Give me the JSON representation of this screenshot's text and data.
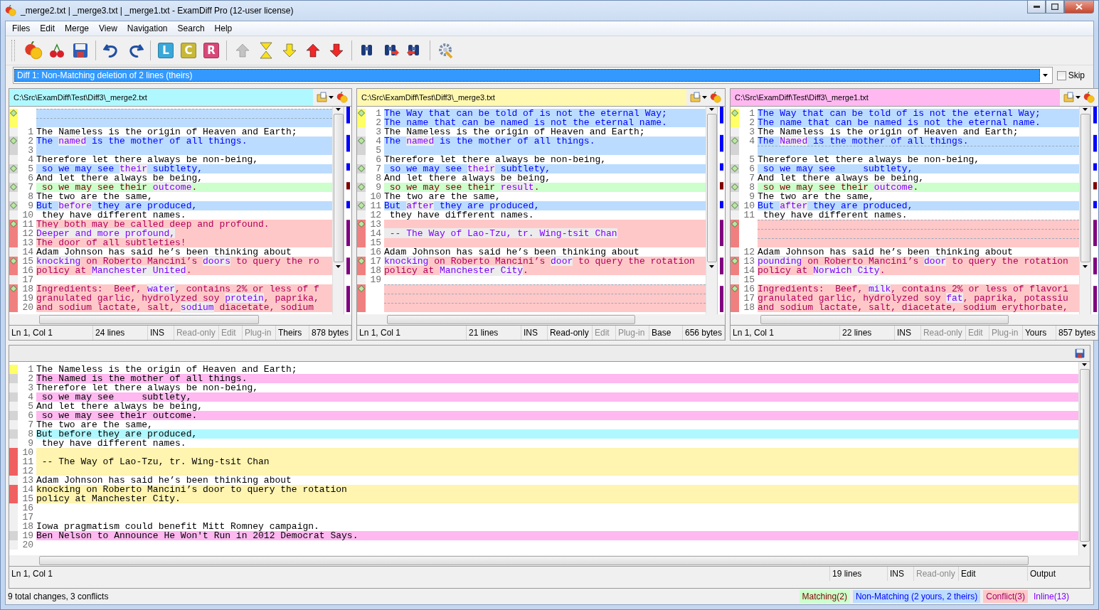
{
  "window": {
    "title": "_merge2.txt  |  _merge3.txt  |  _merge1.txt - ExamDiff Pro (12-user license)"
  },
  "menu": [
    "Files",
    "Edit",
    "Merge",
    "View",
    "Navigation",
    "Search",
    "Help"
  ],
  "toolbar": [
    [
      {
        "kind": "compare",
        "disabled": false
      },
      {
        "kind": "merge",
        "disabled": false
      },
      {
        "kind": "save",
        "disabled": false
      }
    ],
    [
      {
        "kind": "undo",
        "disabled": false
      },
      {
        "kind": "redo",
        "disabled": false
      }
    ],
    [
      {
        "kind": "letter",
        "label": "L",
        "color": "#3aa8d8",
        "disabled": false
      },
      {
        "kind": "letter",
        "label": "C",
        "color": "#c8b838",
        "disabled": false
      },
      {
        "kind": "letter",
        "label": "R",
        "color": "#d84878",
        "disabled": false
      }
    ],
    [
      {
        "kind": "prev-diff",
        "disabled": true
      },
      {
        "kind": "current-diff",
        "disabled": false
      },
      {
        "kind": "next-diff",
        "disabled": false
      },
      {
        "kind": "prev-conflict",
        "disabled": false
      },
      {
        "kind": "next-conflict",
        "disabled": false
      }
    ],
    [
      {
        "kind": "find",
        "disabled": false
      },
      {
        "kind": "find-next",
        "disabled": false
      },
      {
        "kind": "find-prev",
        "disabled": false
      }
    ],
    [
      {
        "kind": "options",
        "disabled": false
      }
    ]
  ],
  "diff_selector": {
    "value": "Diff 1: Non-Matching deletion of 2 lines (theirs)",
    "skip": {
      "label": "Skip",
      "checked": false
    }
  },
  "panes": [
    {
      "path": "C:\\Src\\ExamDiff\\Test\\Diff3\\_merge2.txt",
      "color": "#b0f8ff",
      "blocks": [
        {
          "kind": "nonmatching",
          "current": true,
          "lines": [
            {
              "gap": true
            },
            {
              "gap": true
            }
          ]
        },
        {
          "kind": "plain",
          "current": false,
          "lines": [
            {
              "number": "1",
              "text": "The Nameless is the origin of Heaven and Earth;"
            }
          ]
        },
        {
          "kind": "nonmatching",
          "current": false,
          "lines": [
            {
              "number": "2",
              "segments": [
                {
                  "text": "The ",
                  "inline": false
                },
                {
                  "text": "named",
                  "inline": true
                },
                {
                  "text": " is the mother of all things.",
                  "inline": false
                }
              ]
            },
            {
              "number": "3"
            }
          ]
        },
        {
          "kind": "plain",
          "current": false,
          "lines": [
            {
              "number": "4",
              "text": "Therefore let there always be non-being,"
            }
          ]
        },
        {
          "kind": "nonmatching",
          "current": false,
          "lines": [
            {
              "number": "5",
              "segments": [
                {
                  "text": " so we may see ",
                  "inline": false
                },
                {
                  "text": "their",
                  "inline": true
                },
                {
                  "text": " subtlety,",
                  "inline": false
                }
              ]
            }
          ]
        },
        {
          "kind": "plain",
          "current": false,
          "lines": [
            {
              "number": "6",
              "text": "And let there always be being,"
            }
          ]
        },
        {
          "kind": "matching",
          "current": false,
          "lines": [
            {
              "number": "7",
              "segments": [
                {
                  "text": " so we may see their ",
                  "inline": false
                },
                {
                  "text": "outcome",
                  "inline": true
                },
                {
                  "text": ".",
                  "inline": false
                }
              ]
            }
          ]
        },
        {
          "kind": "plain",
          "current": false,
          "lines": [
            {
              "number": "8",
              "text": "The two are the same,"
            }
          ]
        },
        {
          "kind": "nonmatching",
          "current": false,
          "lines": [
            {
              "number": "9",
              "segments": [
                {
                  "text": "But ",
                  "inline": false
                },
                {
                  "text": "before",
                  "inline": true
                },
                {
                  "text": " they are produced,",
                  "inline": false
                }
              ]
            }
          ]
        },
        {
          "kind": "plain",
          "current": false,
          "lines": [
            {
              "number": "10",
              "text": " they have different names."
            }
          ]
        },
        {
          "kind": "conflict",
          "current": false,
          "lines": [
            {
              "number": "11",
              "text": "They both may be called deep and profound."
            },
            {
              "number": "12",
              "segments": [
                {
                  "text": "Deeper and more profound,",
                  "inline": true
                }
              ]
            },
            {
              "number": "13",
              "text": "The door of all subtleties!"
            }
          ]
        },
        {
          "kind": "plain",
          "current": false,
          "lines": [
            {
              "number": "14",
              "text": "Adam Johnson has said he’s been thinking about"
            }
          ]
        },
        {
          "kind": "conflict",
          "current": false,
          "lines": [
            {
              "number": "15",
              "segments": [
                {
                  "text": "knocking",
                  "inline": true
                },
                {
                  "text": " on Roberto Mancini’s ",
                  "inline": false
                },
                {
                  "text": "doors",
                  "inline": true
                },
                {
                  "text": " to query the ro",
                  "inline": false
                }
              ]
            },
            {
              "number": "16",
              "segments": [
                {
                  "text": "policy at ",
                  "inline": false
                },
                {
                  "text": "Manchester ",
                  "inline": true
                },
                {
                  "text": "United",
                  "inline": true
                },
                {
                  "text": ".",
                  "inline": false
                }
              ]
            }
          ]
        },
        {
          "kind": "plain",
          "current": false,
          "lines": [
            {
              "number": "17"
            }
          ]
        },
        {
          "kind": "conflict",
          "current": false,
          "lines": [
            {
              "number": "18",
              "segments": [
                {
                  "text": "Ingredients:  Beef, ",
                  "inline": false
                },
                {
                  "text": "water",
                  "inline": true
                },
                {
                  "text": ", contains 2% or less of f",
                  "inline": false
                }
              ]
            },
            {
              "number": "19",
              "segments": [
                {
                  "text": "granulated garlic, hydrolyzed soy ",
                  "inline": false
                },
                {
                  "text": "protein",
                  "inline": true
                },
                {
                  "text": ", paprika,",
                  "inline": false
                }
              ]
            },
            {
              "number": "20",
              "segments": [
                {
                  "text": "and sodium lactate, salt, ",
                  "inline": false
                },
                {
                  "text": "sodium",
                  "inline": true
                },
                {
                  "text": " diacetate, sodium",
                  "inline": false
                }
              ]
            }
          ]
        }
      ],
      "status": [
        {
          "text": "Ln 1, Col 1",
          "disabled": false
        },
        {
          "text": "24 lines",
          "disabled": false
        },
        {
          "text": "INS",
          "disabled": false
        },
        {
          "text": "Read-only",
          "disabled": true
        },
        {
          "text": "Edit",
          "disabled": true
        },
        {
          "text": "Plug-in",
          "disabled": true
        },
        {
          "text": "Theirs",
          "disabled": false
        },
        {
          "text": "878 bytes",
          "disabled": false
        }
      ]
    },
    {
      "path": "C:\\Src\\ExamDiff\\Test\\Diff3\\_merge3.txt",
      "color": "#fff8b0",
      "blocks": [
        {
          "kind": "nonmatching",
          "current": true,
          "lines": [
            {
              "number": "1",
              "text": "The Way that can be told of is not the eternal Way;"
            },
            {
              "number": "2",
              "text": "The name that can be named is not the eternal name."
            }
          ]
        },
        {
          "kind": "plain",
          "current": false,
          "lines": [
            {
              "number": "3",
              "text": "The Nameless is the origin of Heaven and Earth;"
            }
          ]
        },
        {
          "kind": "nonmatching",
          "current": false,
          "lines": [
            {
              "number": "4",
              "segments": [
                {
                  "text": "The ",
                  "inline": false
                },
                {
                  "text": "named",
                  "inline": true
                },
                {
                  "text": " is the mother of all things.",
                  "inline": false
                }
              ]
            },
            {
              "number": "5"
            }
          ]
        },
        {
          "kind": "plain",
          "current": false,
          "lines": [
            {
              "number": "6",
              "text": "Therefore let there always be non-being,"
            }
          ]
        },
        {
          "kind": "nonmatching",
          "current": false,
          "lines": [
            {
              "number": "7",
              "segments": [
                {
                  "text": " so we may see ",
                  "inline": false
                },
                {
                  "text": "their",
                  "inline": true
                },
                {
                  "text": " subtlety,",
                  "inline": false
                }
              ]
            }
          ]
        },
        {
          "kind": "plain",
          "current": false,
          "lines": [
            {
              "number": "8",
              "text": "And let there always be being,"
            }
          ]
        },
        {
          "kind": "matching",
          "current": false,
          "lines": [
            {
              "number": "9",
              "segments": [
                {
                  "text": " so we may see their ",
                  "inline": false
                },
                {
                  "text": "result",
                  "inline": true
                },
                {
                  "text": ".",
                  "inline": false
                }
              ]
            }
          ]
        },
        {
          "kind": "plain",
          "current": false,
          "lines": [
            {
              "number": "10",
              "text": "The two are the same,"
            }
          ]
        },
        {
          "kind": "nonmatching",
          "current": false,
          "lines": [
            {
              "number": "11",
              "segments": [
                {
                  "text": "But ",
                  "inline": false
                },
                {
                  "text": "after",
                  "inline": true
                },
                {
                  "text": " they are produced,",
                  "inline": false
                }
              ]
            }
          ]
        },
        {
          "kind": "plain",
          "current": false,
          "lines": [
            {
              "number": "12",
              "text": " they have different names."
            }
          ]
        },
        {
          "kind": "conflict",
          "current": false,
          "lines": [
            {
              "number": "13"
            },
            {
              "number": "14",
              "segments": [
                {
                  "text": " -- The Way of Lao-Tzu, tr. Wing-tsit Chan",
                  "inline": true
                }
              ]
            },
            {
              "number": "15"
            }
          ]
        },
        {
          "kind": "plain",
          "current": false,
          "lines": [
            {
              "number": "16",
              "text": "Adam Johnson has said he’s been thinking about"
            }
          ]
        },
        {
          "kind": "conflict",
          "current": false,
          "lines": [
            {
              "number": "17",
              "segments": [
                {
                  "text": "knocking",
                  "inline": true
                },
                {
                  "text": " on Roberto Mancini’s ",
                  "inline": false
                },
                {
                  "text": "door",
                  "inline": true
                },
                {
                  "text": " to query the rotation",
                  "inline": false
                }
              ]
            },
            {
              "number": "18",
              "segments": [
                {
                  "text": "policy at ",
                  "inline": false
                },
                {
                  "text": "Manchester ",
                  "inline": true
                },
                {
                  "text": "City",
                  "inline": true
                },
                {
                  "text": ".",
                  "inline": false
                }
              ]
            }
          ]
        },
        {
          "kind": "plain",
          "current": false,
          "lines": [
            {
              "number": "19"
            }
          ]
        },
        {
          "kind": "conflict",
          "current": false,
          "lines": [
            {
              "gap": true
            },
            {
              "gap": true
            },
            {
              "gap": true
            }
          ]
        }
      ],
      "status": [
        {
          "text": "Ln 1, Col 1",
          "disabled": false
        },
        {
          "text": "21 lines",
          "disabled": false
        },
        {
          "text": "INS",
          "disabled": false
        },
        {
          "text": "Read-only",
          "disabled": false
        },
        {
          "text": "Edit",
          "disabled": true
        },
        {
          "text": "Plug-in",
          "disabled": true
        },
        {
          "text": "Base",
          "disabled": false
        },
        {
          "text": "656 bytes",
          "disabled": false
        }
      ]
    },
    {
      "path": "C:\\Src\\ExamDiff\\Test\\Diff3\\_merge1.txt",
      "color": "#ffb8f0",
      "blocks": [
        {
          "kind": "nonmatching",
          "current": true,
          "lines": [
            {
              "number": "1",
              "text": "The Way that can be told of is not the eternal Way;"
            },
            {
              "number": "2",
              "text": "The name that can be named is not the eternal name."
            }
          ]
        },
        {
          "kind": "plain",
          "current": false,
          "lines": [
            {
              "number": "3",
              "text": "The Nameless is the origin of Heaven and Earth;"
            }
          ]
        },
        {
          "kind": "nonmatching",
          "current": false,
          "lines": [
            {
              "number": "4",
              "segments": [
                {
                  "text": "The ",
                  "inline": false
                },
                {
                  "text": "Named",
                  "inline": true
                },
                {
                  "text": " is the mother of all things.",
                  "inline": false
                }
              ]
            },
            {
              "gap": true
            }
          ]
        },
        {
          "kind": "plain",
          "current": false,
          "lines": [
            {
              "number": "5",
              "text": "Therefore let there always be non-being,"
            }
          ]
        },
        {
          "kind": "nonmatching",
          "current": false,
          "lines": [
            {
              "number": "6",
              "text": " so we may see     subtlety,"
            }
          ]
        },
        {
          "kind": "plain",
          "current": false,
          "lines": [
            {
              "number": "7",
              "text": "And let there always be being,"
            }
          ]
        },
        {
          "kind": "matching",
          "current": false,
          "lines": [
            {
              "number": "8",
              "segments": [
                {
                  "text": " so we may see their ",
                  "inline": false
                },
                {
                  "text": "outcome",
                  "inline": true
                },
                {
                  "text": ".",
                  "inline": false
                }
              ]
            }
          ]
        },
        {
          "kind": "plain",
          "current": false,
          "lines": [
            {
              "number": "9",
              "text": "The two are the same,"
            }
          ]
        },
        {
          "kind": "nonmatching",
          "current": false,
          "lines": [
            {
              "number": "10",
              "segments": [
                {
                  "text": "But ",
                  "inline": false
                },
                {
                  "text": "after",
                  "inline": true
                },
                {
                  "text": " they are produced,",
                  "inline": false
                }
              ]
            }
          ]
        },
        {
          "kind": "plain",
          "current": false,
          "lines": [
            {
              "number": "11",
              "text": " they have different names."
            }
          ]
        },
        {
          "kind": "conflict",
          "current": false,
          "lines": [
            {
              "gap": true
            },
            {
              "gap": true
            },
            {
              "gap": true
            }
          ]
        },
        {
          "kind": "plain",
          "current": false,
          "lines": [
            {
              "number": "12",
              "text": "Adam Johnson has said he’s been thinking about"
            }
          ]
        },
        {
          "kind": "conflict",
          "current": false,
          "lines": [
            {
              "number": "13",
              "segments": [
                {
                  "text": "pounding",
                  "inline": true
                },
                {
                  "text": " on Roberto Mancini’s ",
                  "inline": false
                },
                {
                  "text": "door",
                  "inline": true
                },
                {
                  "text": " to query the rotation",
                  "inline": false
                }
              ]
            },
            {
              "number": "14",
              "segments": [
                {
                  "text": "policy at ",
                  "inline": false
                },
                {
                  "text": "Norwich ",
                  "inline": true
                },
                {
                  "text": "City",
                  "inline": true
                },
                {
                  "text": ".",
                  "inline": false
                }
              ]
            }
          ]
        },
        {
          "kind": "plain",
          "current": false,
          "lines": [
            {
              "number": "15"
            }
          ]
        },
        {
          "kind": "conflict",
          "current": false,
          "lines": [
            {
              "number": "16",
              "segments": [
                {
                  "text": "Ingredients:  Beef, ",
                  "inline": false
                },
                {
                  "text": "milk",
                  "inline": true
                },
                {
                  "text": ", contains 2% or less of flavori",
                  "inline": false
                }
              ]
            },
            {
              "number": "17",
              "segments": [
                {
                  "text": "granulated garlic, hydrolyzed soy ",
                  "inline": false
                },
                {
                  "text": "fat",
                  "inline": true
                },
                {
                  "text": ", paprika, potassiu",
                  "inline": false
                }
              ]
            },
            {
              "number": "18",
              "text": "and sodium lactate, salt, diacetate, sodium erythorbate,"
            }
          ]
        }
      ],
      "status": [
        {
          "text": "Ln 1, Col 1",
          "disabled": false
        },
        {
          "text": "22 lines",
          "disabled": false
        },
        {
          "text": "INS",
          "disabled": false
        },
        {
          "text": "Read-only",
          "disabled": true
        },
        {
          "text": "Edit",
          "disabled": true
        },
        {
          "text": "Plug-in",
          "disabled": true
        },
        {
          "text": "Yours",
          "disabled": false
        },
        {
          "text": "857 bytes",
          "disabled": false
        }
      ]
    }
  ],
  "output": {
    "blocks": [
      {
        "kind": "plain",
        "current": true,
        "lines": [
          {
            "number": "1",
            "text": "The Nameless is the origin of Heaven and Earth;"
          }
        ]
      },
      {
        "kind": "yours",
        "current": false,
        "lines": [
          {
            "number": "2",
            "text": "The Named is the mother of all things."
          }
        ]
      },
      {
        "kind": "plain",
        "current": false,
        "lines": [
          {
            "number": "3",
            "text": "Therefore let there always be non-being,"
          }
        ]
      },
      {
        "kind": "yours",
        "current": false,
        "lines": [
          {
            "number": "4",
            "text": " so we may see     subtlety,"
          }
        ]
      },
      {
        "kind": "plain",
        "current": false,
        "lines": [
          {
            "number": "5",
            "text": "And let there always be being,"
          }
        ]
      },
      {
        "kind": "yours",
        "current": false,
        "lines": [
          {
            "number": "6",
            "text": " so we may see their outcome."
          }
        ]
      },
      {
        "kind": "plain",
        "current": false,
        "lines": [
          {
            "number": "7",
            "text": "The two are the same,"
          }
        ]
      },
      {
        "kind": "theirs",
        "current": false,
        "lines": [
          {
            "number": "8",
            "text": "But before they are produced,"
          }
        ]
      },
      {
        "kind": "plain",
        "current": false,
        "lines": [
          {
            "number": "9",
            "text": " they have different names."
          }
        ]
      },
      {
        "kind": "merged",
        "current": false,
        "lines": [
          {
            "number": "10"
          },
          {
            "number": "11",
            "text": " -- The Way of Lao-Tzu, tr. Wing-tsit Chan"
          },
          {
            "number": "12"
          }
        ]
      },
      {
        "kind": "plain",
        "current": false,
        "lines": [
          {
            "number": "13",
            "text": "Adam Johnson has said he’s been thinking about"
          }
        ]
      },
      {
        "kind": "merged",
        "current": false,
        "lines": [
          {
            "number": "14",
            "text": "knocking on Roberto Mancini’s door to query the rotation"
          },
          {
            "number": "15",
            "text": "policy at Manchester City."
          }
        ]
      },
      {
        "kind": "plain",
        "current": false,
        "lines": [
          {
            "number": "16"
          },
          {
            "number": "17"
          },
          {
            "number": "18",
            "text": "Iowa pragmatism could benefit Mitt Romney campaign."
          }
        ]
      },
      {
        "kind": "yours",
        "current": false,
        "lines": [
          {
            "number": "19",
            "text": "Ben Nelson to Announce He Won't Run in 2012 Democrat Says."
          }
        ]
      },
      {
        "kind": "plain",
        "current": false,
        "lines": [
          {
            "number": "20"
          }
        ]
      }
    ],
    "status": [
      {
        "text": "Ln 1, Col 1",
        "disabled": false
      },
      {
        "text": "19 lines",
        "disabled": false
      },
      {
        "text": "INS",
        "disabled": false
      },
      {
        "text": "Read-only",
        "disabled": true
      },
      {
        "text": "Edit",
        "disabled": false
      },
      {
        "text": "Output",
        "disabled": false
      }
    ]
  },
  "status_bar": {
    "summary": "9 total changes, 3 conflicts",
    "legend": [
      {
        "kind": "matching",
        "text": "Matching(2)"
      },
      {
        "kind": "nonmatching",
        "text": "Non-Matching (2 yours, 2 theirs)"
      },
      {
        "kind": "conflict",
        "text": "Conflict(3)"
      },
      {
        "kind": "inline",
        "text": "Inline(13)"
      }
    ]
  }
}
